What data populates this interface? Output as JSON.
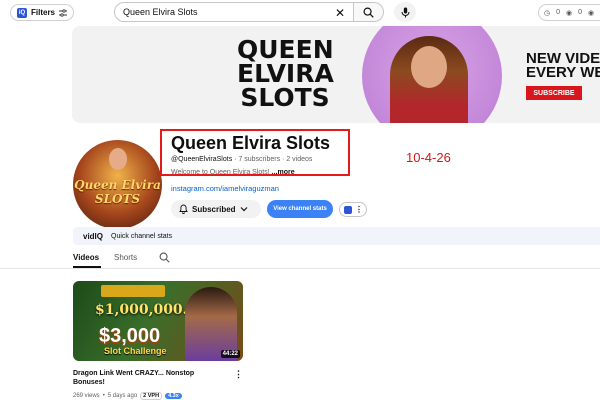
{
  "topbar": {
    "filters_label": "Filters",
    "filters_badge": "iQ",
    "search_value": "Queen Elvira Slots",
    "stats": [
      "0",
      "0",
      "0"
    ]
  },
  "banner": {
    "title": "QUEEN ELVIRA SLOTS",
    "new_video": "NEW VIDE",
    "every_week": "EVERY WE",
    "subscribe": "SUBSCRIBE"
  },
  "channel": {
    "avatar_text": "Queen Elvira SLOTS",
    "name": "Queen Elvira Slots",
    "handle": "@QueenElviraSlots",
    "subscribers": "7 subscribers",
    "videos": "2 videos",
    "separator": " · ",
    "description": "Welcome to Queen Elvira Slots!",
    "more": "...more",
    "link": "instagram.com/iamelviraguzman",
    "subscribed_label": "Subscribed",
    "view_stats_label": "View channel stats"
  },
  "annotation": {
    "date": "10-4-26"
  },
  "quick_stats": {
    "brand": "vidIQ",
    "label": "Quick channel stats"
  },
  "tabs": {
    "videos": "Videos",
    "shorts": "Shorts"
  },
  "video": {
    "jackpot": "$1,000,000.00",
    "amount": "$3,000",
    "challenge": "Slot Challenge",
    "duration": "44:22",
    "title": "Dragon Link Went CRAZY... Nonstop Bonuses!",
    "views": "269 views",
    "age": "5 days ago",
    "vph": "2 VPH",
    "multiplier": "4.3x"
  },
  "colors": {
    "accent": "#065fd4",
    "annotation": "#e41b1b",
    "vidiq_blue": "#3b82f6"
  }
}
